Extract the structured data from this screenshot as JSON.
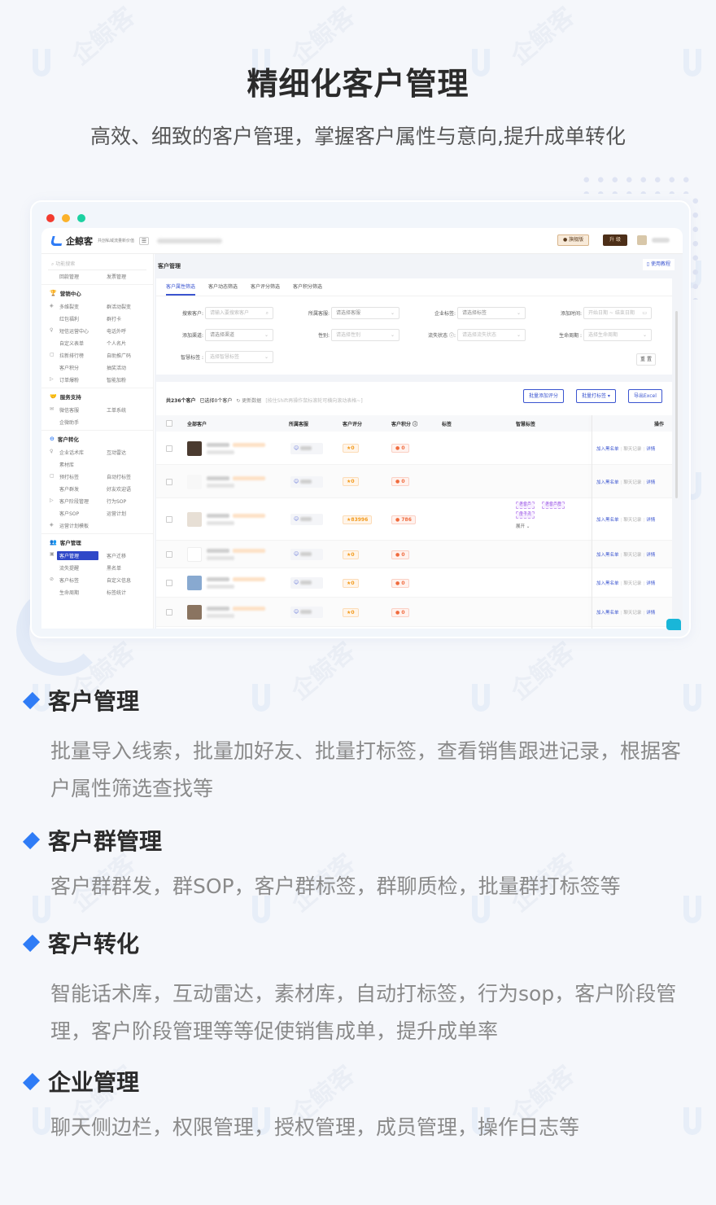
{
  "hero": {
    "title": "精细化客户管理",
    "subtitle": "高效、细致的客户管理，掌握客户属性与意向,提升成单转化"
  },
  "watermark": "企鲸客",
  "colors": {
    "accent": "#2f7cf6",
    "primary": "#3b55d0",
    "upgrade_bg": "#4d2f18",
    "score": "#f39a1c",
    "points": "#f06a3c"
  },
  "app": {
    "window_controls": [
      "close",
      "minimize",
      "maximize"
    ],
    "logo_text": "企鲸客",
    "slogan": "共创私域流量新价值",
    "flagship_label": "旗舰版",
    "upgrade_label": "升 级",
    "sidebar": {
      "search_placeholder": "功能搜索",
      "top_items": [
        "回款管理",
        "发票管理"
      ],
      "groups": [
        {
          "title": "营销中心",
          "icon": "trophy-icon",
          "rows": [
            [
              "多维裂变",
              "群活动裂变"
            ],
            [
              "红包福利",
              "群打卡"
            ],
            [
              "短信运营中心",
              "电话外呼"
            ],
            [
              "自定义表单",
              "个人名片"
            ],
            [
              "拉新排行榜",
              "自助推广码"
            ],
            [
              "客户积分",
              "抽奖活动"
            ],
            [
              "订单爆粉",
              "智能加粉"
            ]
          ]
        },
        {
          "title": "服务支持",
          "icon": "handshake-icon",
          "rows": [
            [
              "微信客服",
              "工单系统"
            ],
            [
              "企微助手",
              ""
            ]
          ]
        },
        {
          "title": "客户转化",
          "icon": "convert-icon",
          "rows": [
            [
              "企业话术库",
              "互动雷达"
            ],
            [
              "素材库",
              ""
            ],
            [
              "预打标签",
              "自动打标签"
            ],
            [
              "客户群发",
              "好友欢迎语"
            ],
            [
              "客户阶段管理",
              "行为SOP"
            ],
            [
              "客户SOP",
              "运营计划"
            ],
            [
              "运营计划模板",
              ""
            ]
          ]
        },
        {
          "title": "客户管理",
          "icon": "users-icon",
          "rows": [
            [
              "客户管理",
              "客户迁移"
            ],
            [
              "流失提醒",
              "黑名单"
            ],
            [
              "客户标签",
              "自定义信息"
            ],
            [
              "生命周期",
              "标签统计"
            ]
          ]
        }
      ],
      "active_item": "客户管理"
    },
    "page_title": "客户管理",
    "tutorial_label": "使用教程",
    "filter_tabs": [
      "客户属性筛选",
      "客户动态筛选",
      "客户评分筛选",
      "客户积分筛选"
    ],
    "active_tab": 0,
    "filters": {
      "search_customer": {
        "label": "搜索客户:",
        "placeholder": "请输入要搜索客户"
      },
      "owner": {
        "label": "所属客服:",
        "value": "请选择客服"
      },
      "corp_tag": {
        "label": "企业标签:",
        "value": "请选择标签"
      },
      "add_time": {
        "label": "添加时间:",
        "placeholder": "开始日期 ~ 结束日期"
      },
      "channel": {
        "label": "添加渠道:",
        "value": "请选择渠道"
      },
      "gender": {
        "label": "性别:",
        "placeholder": "请选择性别"
      },
      "lost_status": {
        "label": "流失状态 ⓘ:",
        "placeholder": "请选择流失状态"
      },
      "lifecycle": {
        "label": "生命周期 :",
        "placeholder": "选择生命周期"
      },
      "smart_tag": {
        "label": "智慧标签 :",
        "placeholder": "选择智慧标签"
      },
      "reset_label": "重 置"
    },
    "list": {
      "total": "共236个客户",
      "selected": "已选择0个客户",
      "refresh": "更新数据",
      "hint": "[按住Shift再操作鼠标滚轮可横向滚动表格~]",
      "batch_score": "批量添加评分",
      "batch_tag": "批量打标签 ▾",
      "export": "导出Excel",
      "columns": [
        "全部客户",
        "所属客服",
        "客户评分",
        "客户积分 ⓘ",
        "标签",
        "智慧标签",
        "操作"
      ],
      "rows": [
        {
          "score": "0",
          "points": "0",
          "smart_tags": []
        },
        {
          "score": "0",
          "points": "0",
          "smart_tags": []
        },
        {
          "score": "83996",
          "points": "786",
          "smart_tags": [
            "老客户",
            "老客户群",
            "度卡点"
          ],
          "expand": "展开 ⌄"
        },
        {
          "score": "0",
          "points": "0",
          "smart_tags": []
        },
        {
          "score": "0",
          "points": "0",
          "smart_tags": []
        },
        {
          "score": "0",
          "points": "0",
          "smart_tags": []
        }
      ],
      "ops": {
        "blacklist": "加入黑名单",
        "chat": "聊天记录",
        "detail": "详情"
      }
    }
  },
  "features": [
    {
      "title": "客户管理",
      "desc": "批量导入线索，批量加好友、批量打标签，查看销售跟进记录，根据客户属性筛选查找等"
    },
    {
      "title": "客户群管理",
      "desc": "客户群群发，群SOP，客户群标签，群聊质检，批量群打标签等"
    },
    {
      "title": "客户转化",
      "desc": "智能话术库，互动雷达，素材库，自动打标签，行为sop，客户阶段管理，客户阶段管理等等促使销售成单，提升成单率"
    },
    {
      "title": "企业管理",
      "desc": "聊天侧边栏，权限管理，授权管理，成员管理，操作日志等"
    }
  ]
}
